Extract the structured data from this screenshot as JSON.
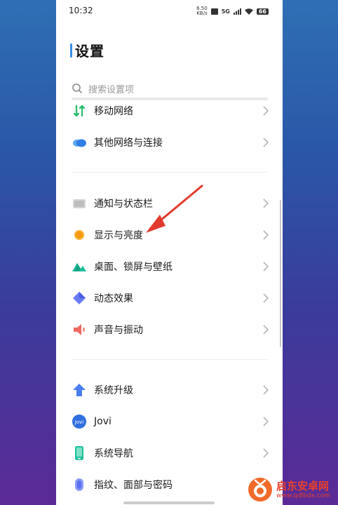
{
  "status_bar": {
    "time": "10:32",
    "net_speed_top": "6.50",
    "net_speed_bottom": "KB/s",
    "network": "5G",
    "battery": "66"
  },
  "header": {
    "title": "设置"
  },
  "search": {
    "placeholder": "搜索设置项"
  },
  "groups": [
    {
      "items": [
        {
          "label": "移动网络",
          "icon": "mobile-network-icon",
          "color": "#2fbf71"
        },
        {
          "label": "其他网络与连接",
          "icon": "cloud-icon",
          "color": "#3b8cf0"
        }
      ]
    },
    {
      "items": [
        {
          "label": "通知与状态栏",
          "icon": "notification-icon",
          "color": "#b9b9b9"
        },
        {
          "label": "显示与亮度",
          "icon": "sun-icon",
          "color": "#f6a21a"
        },
        {
          "label": "桌面、锁屏与壁纸",
          "icon": "mountain-icon",
          "color": "#1fbf9b"
        },
        {
          "label": "动态效果",
          "icon": "diamond-icon",
          "color": "#5a6ff0"
        },
        {
          "label": "声音与振动",
          "icon": "speaker-icon",
          "color": "#f05a55"
        }
      ]
    },
    {
      "items": [
        {
          "label": "系统升级",
          "icon": "upgrade-arrow-icon",
          "color": "#4a7df0"
        },
        {
          "label": "Jovi",
          "icon": "jovi-icon",
          "color": "#2f6fe0"
        },
        {
          "label": "系统导航",
          "icon": "phone-navigation-icon",
          "color": "#1fbf9b"
        },
        {
          "label": "指纹、面部与密码",
          "icon": "fingerprint-icon",
          "color": "#6a7cf0"
        }
      ]
    }
  ],
  "watermark": {
    "name": "启东安卓网",
    "url": "www.qdlbdx.com"
  }
}
